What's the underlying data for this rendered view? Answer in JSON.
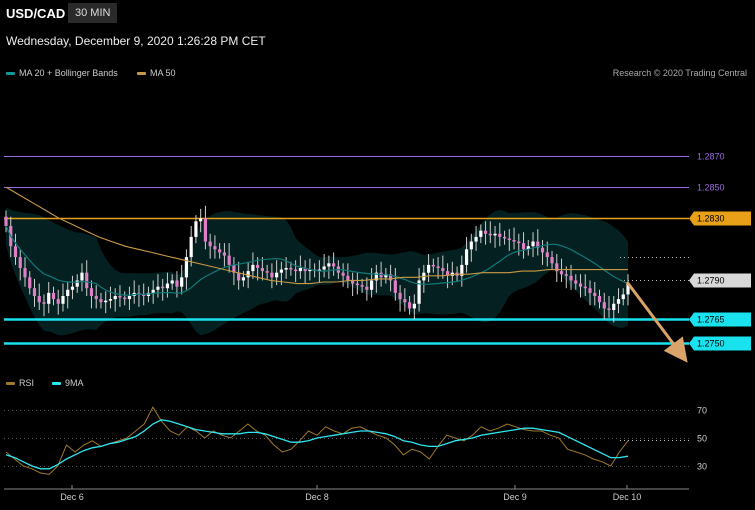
{
  "header": {
    "symbol": "USD/CAD",
    "timeframe": "30 MIN",
    "datetime": "Wednesday, December 9, 2020 1:26:28 PM CET"
  },
  "legend": {
    "ma20": "MA 20 + Bollinger Bands",
    "ma50": "MA 50",
    "credit": "Research © 2020 Trading Central"
  },
  "rsi_legend": {
    "rsi": "RSI",
    "ma": "9MA"
  },
  "colors": {
    "bollinger": "#0e7a78",
    "ma50": "#c99a45",
    "rsi": "#a07a2c",
    "rsi_ma": "#2ee6f0",
    "res_purple": "#9a6ae0",
    "res_orange": "#e8a019",
    "support_cyan": "#19e2ee",
    "arrow": "#d9a36a"
  },
  "chart_data": [
    {
      "type": "candlestick",
      "x_ticks": [
        "Dec 6",
        "Dec 8",
        "Dec 9",
        "Dec 10"
      ],
      "ylim": [
        1.2735,
        1.2915
      ],
      "levels": [
        {
          "value": "1.2870",
          "kind": "resistance-purple"
        },
        {
          "value": "1.2850",
          "kind": "resistance-purple"
        },
        {
          "value": "1.2830",
          "kind": "resistance-orange"
        },
        {
          "value": "1.2790",
          "kind": "current"
        },
        {
          "value": "1.2765",
          "kind": "support-cyan"
        },
        {
          "value": "1.2750",
          "kind": "support-cyan"
        }
      ],
      "close_series": [
        1.2825,
        1.2812,
        1.2805,
        1.2798,
        1.2792,
        1.2785,
        1.278,
        1.2776,
        1.2775,
        1.2782,
        1.2778,
        1.2775,
        1.278,
        1.2784,
        1.2786,
        1.279,
        1.2795,
        1.2785,
        1.278,
        1.2778,
        1.2776,
        1.2777,
        1.2778,
        1.278,
        1.2779,
        1.2778,
        1.278,
        1.2782,
        1.2781,
        1.278,
        1.2782,
        1.2784,
        1.2786,
        1.2785,
        1.2788,
        1.279,
        1.2786,
        1.2792,
        1.2805,
        1.2818,
        1.2828,
        1.283,
        1.2815,
        1.2812,
        1.281,
        1.2808,
        1.2806,
        1.28,
        1.2795,
        1.279,
        1.2792,
        1.2796,
        1.28,
        1.2798,
        1.2796,
        1.2795,
        1.2792,
        1.2795,
        1.2797,
        1.2798,
        1.2797,
        1.2796,
        1.2798,
        1.2796,
        1.2797,
        1.2796,
        1.2797,
        1.2799,
        1.2801,
        1.2799,
        1.2795,
        1.2793,
        1.279,
        1.2788,
        1.2787,
        1.2786,
        1.2784,
        1.279,
        1.2795,
        1.2792,
        1.2794,
        1.279,
        1.2782,
        1.2778,
        1.2776,
        1.2772,
        1.2775,
        1.279,
        1.2795,
        1.28,
        1.2799,
        1.2798,
        1.2796,
        1.2793,
        1.2795,
        1.2793,
        1.28,
        1.281,
        1.2815,
        1.2818,
        1.2822,
        1.282,
        1.2819,
        1.282,
        1.2818,
        1.2817,
        1.2816,
        1.2815,
        1.2814,
        1.281,
        1.2812,
        1.2815,
        1.2811,
        1.2808,
        1.2805,
        1.2801,
        1.2796,
        1.2794,
        1.2793,
        1.279,
        1.2788,
        1.2786,
        1.2785,
        1.2782,
        1.278,
        1.2776,
        1.2772,
        1.2771,
        1.2775,
        1.2778,
        1.2781,
        1.2788
      ],
      "ma50_series": [
        1.285,
        1.2845,
        1.284,
        1.2835,
        1.283,
        1.2826,
        1.2822,
        1.2818,
        1.2815,
        1.2812,
        1.281,
        1.2808,
        1.2806,
        1.2804,
        1.2802,
        1.28,
        1.2798,
        1.2796,
        1.2794,
        1.2792,
        1.279,
        1.2789,
        1.2788,
        1.2788,
        1.2789,
        1.2789,
        1.279,
        1.279,
        1.2791,
        1.2791,
        1.2792,
        1.2792,
        1.2793,
        1.2793,
        1.2794,
        1.2794,
        1.2795,
        1.2795,
        1.2795,
        1.2796,
        1.2796,
        1.2797,
        1.2797,
        1.2797,
        1.2797,
        1.2797,
        1.2797,
        1.2797
      ]
    },
    {
      "type": "line",
      "name": "RSI",
      "y_ticks": [
        "70",
        "50",
        "30"
      ],
      "ylim": [
        20,
        80
      ],
      "rsi_series": [
        40,
        35,
        30,
        28,
        25,
        24,
        30,
        45,
        40,
        45,
        48,
        44,
        46,
        48,
        50,
        55,
        60,
        72,
        62,
        55,
        52,
        58,
        55,
        50,
        55,
        52,
        50,
        55,
        60,
        55,
        52,
        45,
        40,
        42,
        48,
        55,
        52,
        58,
        55,
        53,
        57,
        58,
        55,
        52,
        50,
        45,
        38,
        42,
        40,
        35,
        44,
        52,
        50,
        48,
        52,
        58,
        55,
        57,
        60,
        58,
        56,
        55,
        55,
        52,
        50,
        42,
        40,
        38,
        35,
        33,
        30,
        40,
        48
      ],
      "ma_series": [
        38,
        36,
        33,
        30,
        28,
        28,
        31,
        35,
        38,
        41,
        43,
        44,
        46,
        47,
        49,
        51,
        55,
        60,
        63,
        62,
        60,
        58,
        56,
        55,
        54,
        53,
        53,
        53,
        54,
        54,
        53,
        51,
        49,
        47,
        47,
        48,
        50,
        51,
        52,
        53,
        54,
        55,
        55,
        54,
        53,
        51,
        48,
        47,
        45,
        44,
        44,
        46,
        48,
        49,
        50,
        52,
        53,
        54,
        55,
        56,
        57,
        57,
        56,
        55,
        54,
        51,
        48,
        45,
        42,
        39,
        36,
        36,
        37
      ]
    }
  ]
}
